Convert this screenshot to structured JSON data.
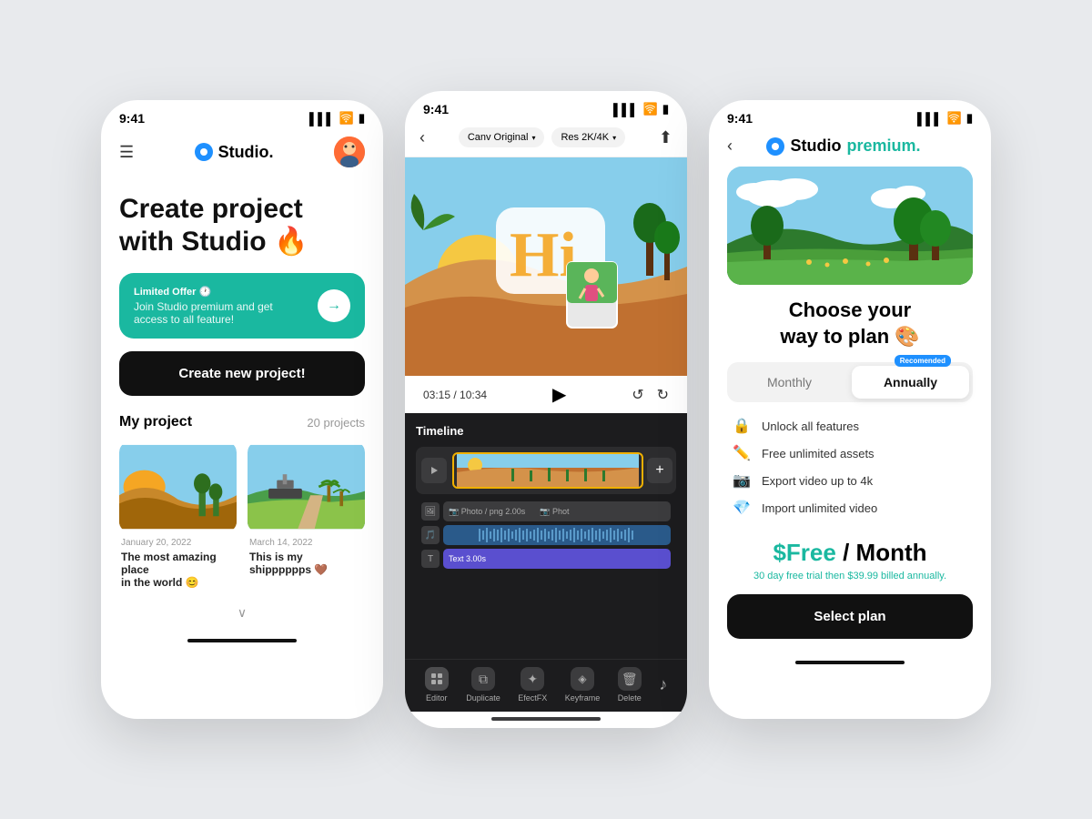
{
  "screen1": {
    "status_time": "9:41",
    "logo": "Studio.",
    "hero_text": "Create project\nwith Studio 🔥",
    "promo": {
      "label": "Limited Offer 🕐",
      "desc": "Join Studio premium and get\naccess to all feature!",
      "arrow": "→"
    },
    "create_btn": "Create new project!",
    "projects_title": "My project",
    "projects_count": "20 projects",
    "projects": [
      {
        "date": "January 20, 2022",
        "name": "The most amazing place\nin the world 😊"
      },
      {
        "date": "March 14, 2022",
        "name": "This is my shipppppps 🤎"
      }
    ]
  },
  "screen2": {
    "status_time": "9:41",
    "canv_label": "Canv Original",
    "res_label": "Res 2K/4K",
    "time_current": "03:15",
    "time_total": "10:34",
    "timeline_label": "Timeline",
    "tools": [
      "Editor",
      "Duplicate",
      "EfectFX",
      "Keyframe",
      "Delete"
    ],
    "photo_track_label": "Photo / png  2.00s",
    "text_track_label": "Text  3.00s"
  },
  "screen3": {
    "status_time": "9:41",
    "logo": "Studio",
    "premium_text": "premium.",
    "choose_title": "Choose your\nway to plan 🎨",
    "plan_monthly": "Monthly",
    "plan_annually": "Annually",
    "recommended": "Recomended",
    "features": [
      {
        "emoji": "🔒",
        "text": "Unlock all features"
      },
      {
        "emoji": "✏️",
        "text": "Free unlimited assets"
      },
      {
        "emoji": "📷",
        "text": "Export video up to 4k"
      },
      {
        "emoji": "💎",
        "text": "Import unlimited video"
      }
    ],
    "price_amount": "$Free",
    "price_period": "/ Month",
    "trial_text": "30 day free trial then $39.99 billed annually.",
    "select_btn": "Select plan"
  }
}
